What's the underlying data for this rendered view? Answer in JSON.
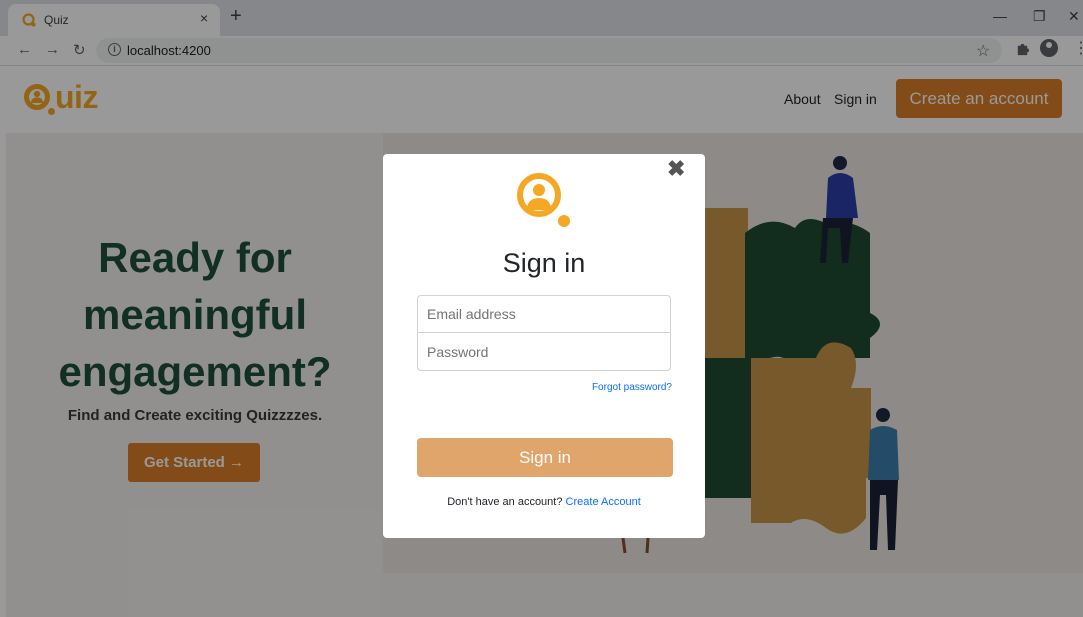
{
  "browser": {
    "tab_title": "Quiz",
    "tab_close": "×",
    "new_tab": "+",
    "url": "localhost:4200",
    "controls": {
      "minimize": "—",
      "restore": "❐",
      "close": "✕"
    }
  },
  "header": {
    "logo_text": "uiz",
    "nav": {
      "about": "About",
      "signin": "Sign in"
    },
    "cta": "Create an account"
  },
  "hero": {
    "title": "Ready for meaningful engagement?",
    "subtitle": "Find and Create exciting Quizzzzes.",
    "button": "Get Started →"
  },
  "modal": {
    "title": "Sign in",
    "email_placeholder": "Email address",
    "password_placeholder": "Password",
    "forgot": "Forgot password?",
    "submit": "Sign in",
    "no_account": "Don't have an account?",
    "create_link": "Create Account",
    "close": "✖"
  },
  "colors": {
    "brand_orange": "#d97e27",
    "logo_yellow": "#f4a823",
    "hero_green": "#1d4f3c",
    "puzzle_green": "#1e4a32",
    "puzzle_tan": "#c89448",
    "link_blue": "#0d6efd"
  },
  "icons": {
    "back": "arrow-left-icon",
    "forward": "arrow-right-icon",
    "reload": "reload-icon",
    "info": "info-icon",
    "bookmark": "star-icon",
    "extensions": "puzzle-icon",
    "profile": "account-icon",
    "menu": "kebab-menu-icon"
  }
}
